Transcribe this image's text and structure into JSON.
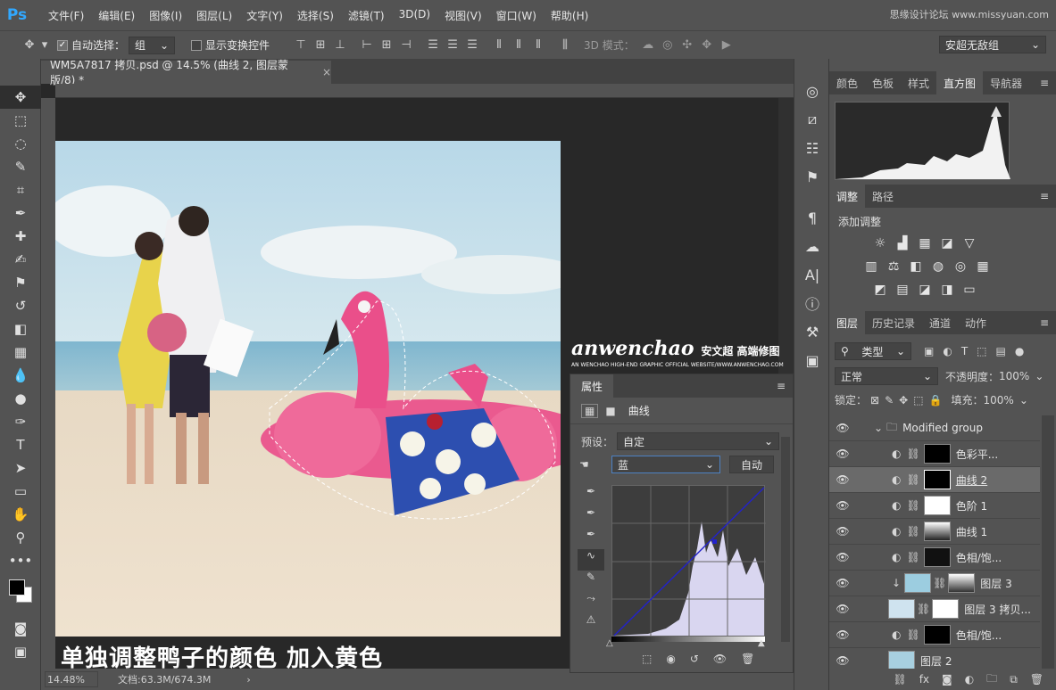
{
  "app": {
    "logo": "Ps",
    "watermark": "思缘设计论坛 www.missyuan.com"
  },
  "menu": [
    "文件(F)",
    "编辑(E)",
    "图像(I)",
    "图层(L)",
    "文字(Y)",
    "选择(S)",
    "滤镜(T)",
    "3D(D)",
    "视图(V)",
    "窗口(W)",
    "帮助(H)"
  ],
  "options": {
    "auto_select_label": "自动选择：",
    "auto_select_value": "组",
    "show_transform_label": "显示变换控件",
    "mode_3d_label": "3D 模式：",
    "workspace": "安超无敌组"
  },
  "document": {
    "tab_title": "WM5A7817 拷贝.psd @ 14.5% (曲线 2, 图层蒙版/8) *",
    "zoom": "14.48%",
    "doc_info": "文档:63.3M/674.3M",
    "caption": "单独调整鸭子的颜色 加入黄色",
    "brand_name": "anwenchao",
    "brand_cn": "安文超 高端修图",
    "brand_sub": "AN WENCHAO HIGH-END GRAPHIC OFFICIAL WEBSITE/WWW.ANWENCHAO.COM"
  },
  "properties": {
    "tab": "属性",
    "type_label": "曲线",
    "preset_label": "预设：",
    "preset_value": "自定",
    "channel_value": "蓝",
    "auto_button": "自动"
  },
  "top_panel": {
    "tabs": [
      "颜色",
      "色板",
      "样式",
      "直方图",
      "导航器"
    ],
    "active": "直方图"
  },
  "adjust_panel": {
    "tabs": [
      "调整",
      "路径"
    ],
    "add_label": "添加调整"
  },
  "layers_panel": {
    "tabs": [
      "图层",
      "历史记录",
      "通道",
      "动作"
    ],
    "filter": "类型",
    "blend_mode": "正常",
    "opacity_label": "不透明度：",
    "opacity": "100%",
    "lock_label": "锁定：",
    "fill_label": "填充：",
    "fill": "100%",
    "group_name": "Modified group",
    "layers": [
      {
        "name": "色彩平..."
      },
      {
        "name": "曲线 2"
      },
      {
        "name": "色阶 1"
      },
      {
        "name": "曲线 1"
      },
      {
        "name": "色相/饱..."
      },
      {
        "name": "图层 3"
      },
      {
        "name": "图层 3 拷贝..."
      },
      {
        "name": "色相/饱..."
      },
      {
        "name": "图层 2"
      }
    ]
  },
  "colors": {
    "accent": "#31a8ff",
    "curve": "#2222cc"
  }
}
